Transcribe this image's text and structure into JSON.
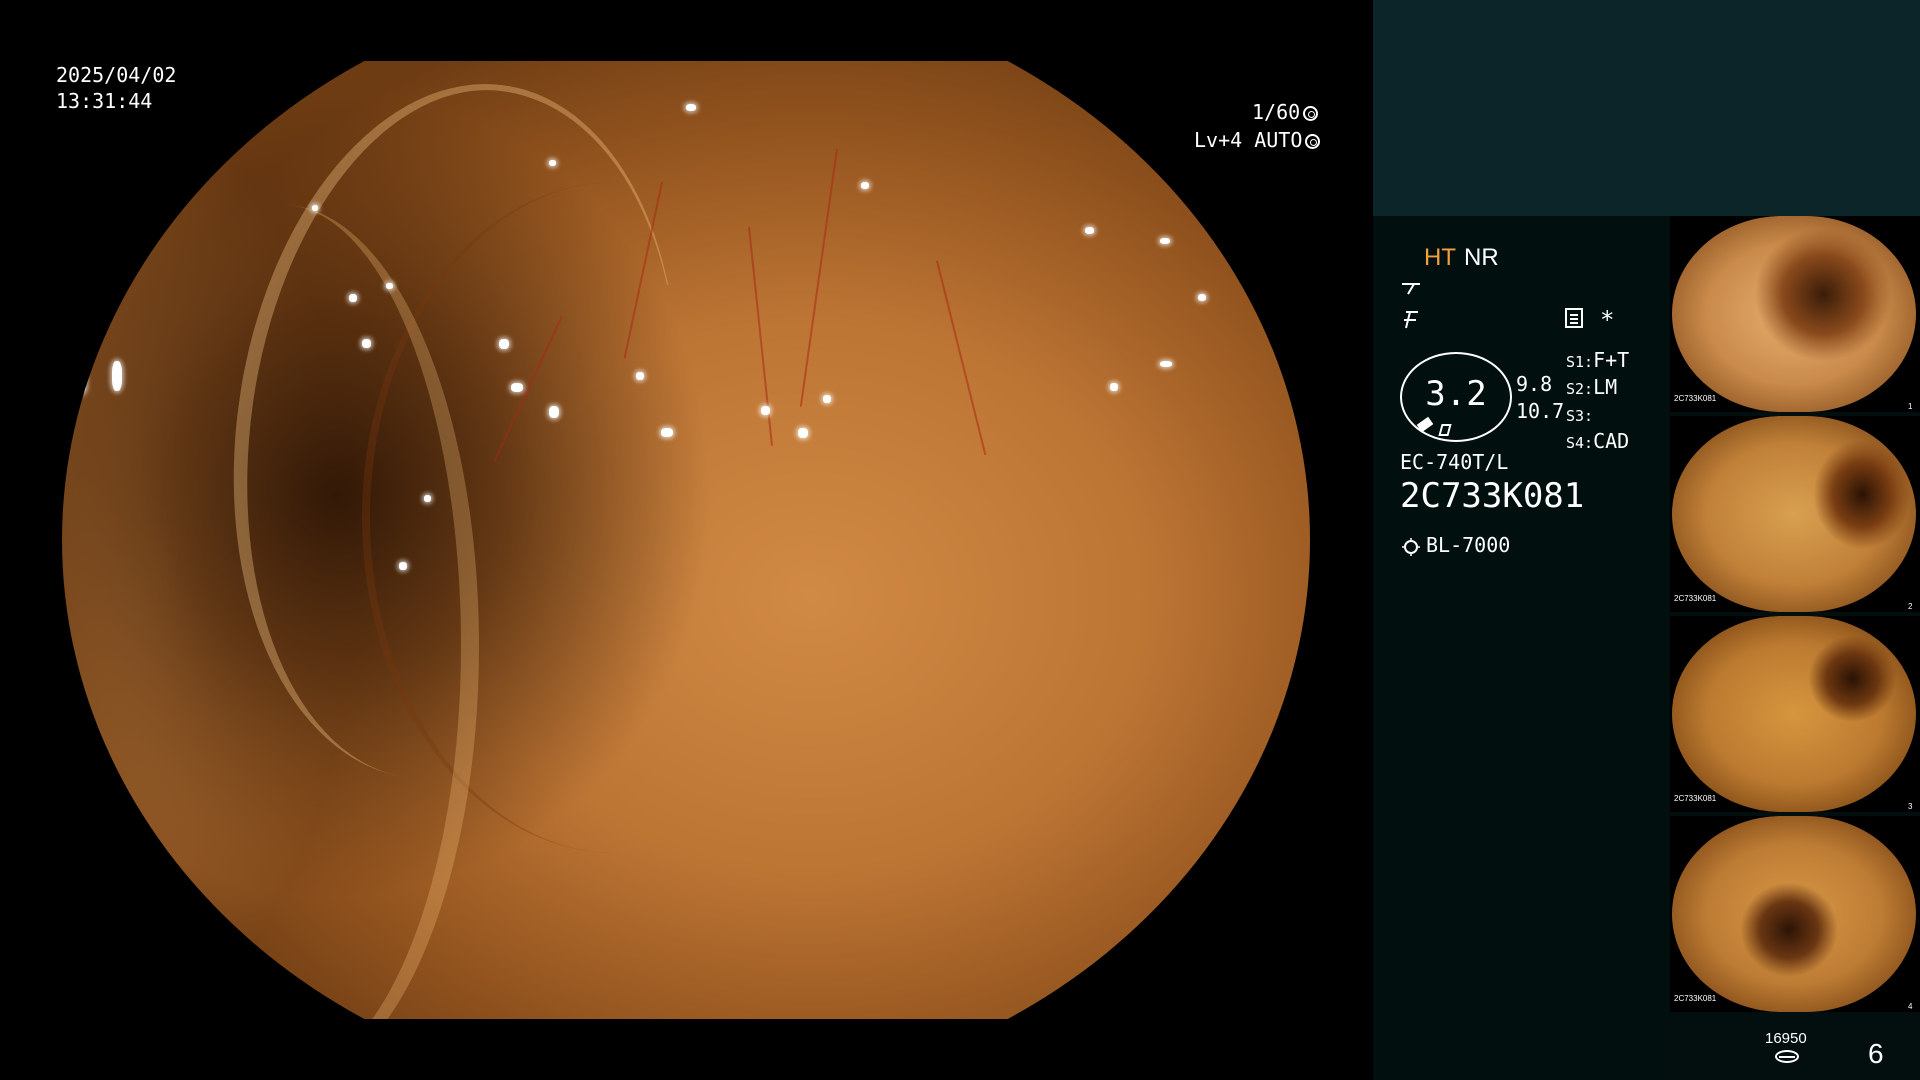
{
  "overlay": {
    "date": "2025/04/02",
    "time": "13:31:44",
    "shutter": "1/60",
    "level": "Lv+4",
    "mode": "AUTO"
  },
  "panel": {
    "mode_ht": "HT",
    "mode_nr": "NR",
    "zoom": "3.2",
    "sub_value_1": "9.8",
    "sub_value_2": "10.7",
    "settings": [
      {
        "label": "S1:",
        "value": "F+T"
      },
      {
        "label": "S2:",
        "value": "LM"
      },
      {
        "label": "S3:",
        "value": ""
      },
      {
        "label": "S4:",
        "value": "CAD"
      }
    ],
    "asterisk": "*",
    "scope_model": "EC-740T/L",
    "scope_serial": "2C733K081",
    "light_source": "BL-7000"
  },
  "thumbnails": [
    {
      "caption": "2C733K081",
      "index": "1"
    },
    {
      "caption": "2C733K081",
      "index": "2"
    },
    {
      "caption": "2C733K081",
      "index": "3"
    },
    {
      "caption": "2C733K081",
      "index": "4"
    }
  ],
  "footer": {
    "counter": "16950",
    "page": "6"
  },
  "colors": {
    "ht_accent": "#f0a040",
    "panel_top": "#0b2528",
    "panel_bg": "#020f0f"
  },
  "icons": [
    "shutter-icon",
    "auto-ring-icon",
    "scope-tip-icon",
    "freeze-icon",
    "menu-icon",
    "sun-icon",
    "media-counter-icon"
  ]
}
